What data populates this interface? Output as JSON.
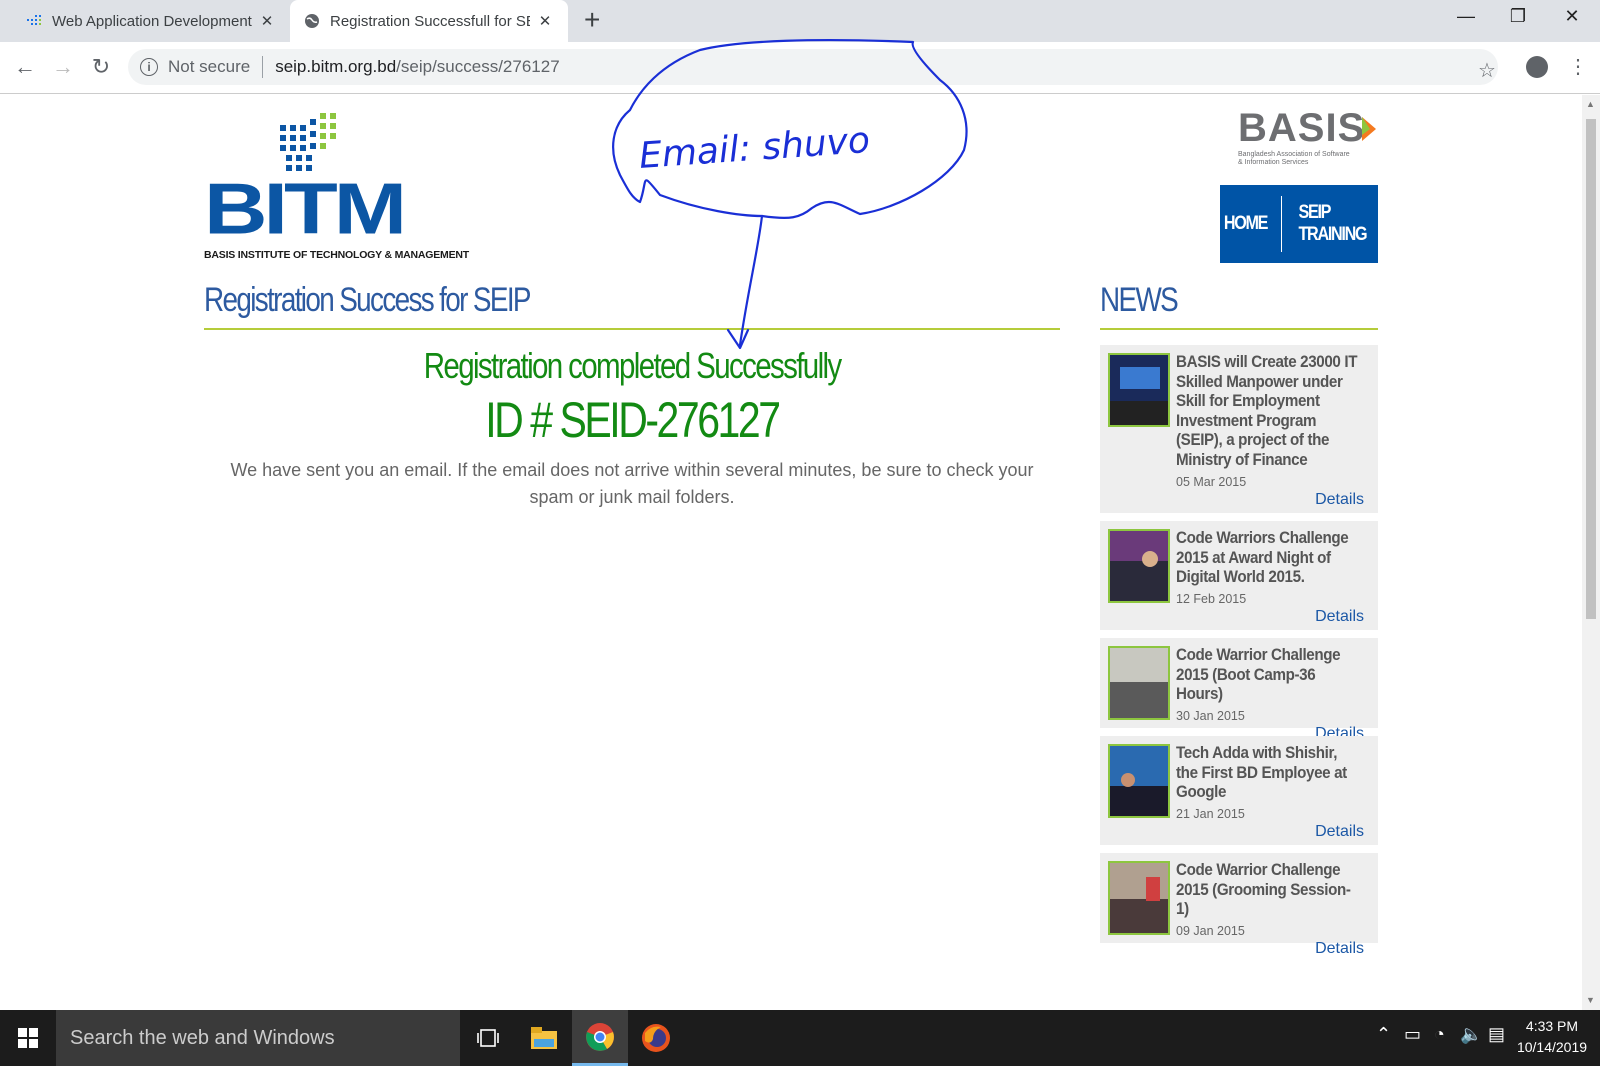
{
  "browser": {
    "tabs": [
      {
        "title": "Web Application Development w",
        "active": false
      },
      {
        "title": "Registration Successfull for SEIP|",
        "active": true
      }
    ],
    "url": {
      "security": "Not secure",
      "domain": "seip.bitm.org.bd",
      "path": "/seip/success/276127"
    }
  },
  "header": {
    "logo": {
      "word": "BITM",
      "subtitle": "BASIS INSTITUTE OF TECHNOLOGY & MANAGEMENT",
      "color": "#0c56a4"
    },
    "partner_logo": {
      "word": "BASIS",
      "subtitle": "Bangladesh Association of Software & Information Services"
    },
    "nav": [
      {
        "label": "HOME"
      },
      {
        "label": "SEIP TRAINING"
      }
    ]
  },
  "main": {
    "title": "Registration Success for SEIP",
    "success_heading": "Registration completed Successfully",
    "registration_id": "ID # SEID-276127",
    "message": "We have sent you an email. If the email does not arrive within several minutes, be sure to check your spam or junk mail folders."
  },
  "news": {
    "title": "NEWS",
    "details_label": "Details",
    "items": [
      {
        "title": "BASIS will Create 23000 IT Skilled Manpower under Skill for Employment Investment Program (SEIP), a project of the Ministry of Finance",
        "date": "05 Mar 2015"
      },
      {
        "title": "Code Warriors Challenge 2015 at Award Night of Digital World 2015.",
        "date": "12 Feb 2015"
      },
      {
        "title": "Code Warrior Challenge 2015 (Boot Camp-36 Hours)",
        "date": "30 Jan 2015"
      },
      {
        "title": "Tech Adda with Shishir, the First BD Employee at Google",
        "date": "21 Jan 2015"
      },
      {
        "title": "Code Warrior Challenge 2015 (Grooming Session-1)",
        "date": "09 Jan 2015"
      }
    ]
  },
  "annotation": {
    "text": "Email: shuvo"
  },
  "taskbar": {
    "search_placeholder": "Search the web and Windows",
    "time": "4:33 PM",
    "date": "10/14/2019"
  },
  "colors": {
    "accent_blue": "#0054a6",
    "success_green": "#138a13",
    "rule_green": "#b5cc3a",
    "annotation_ink": "#1a2fd6"
  }
}
